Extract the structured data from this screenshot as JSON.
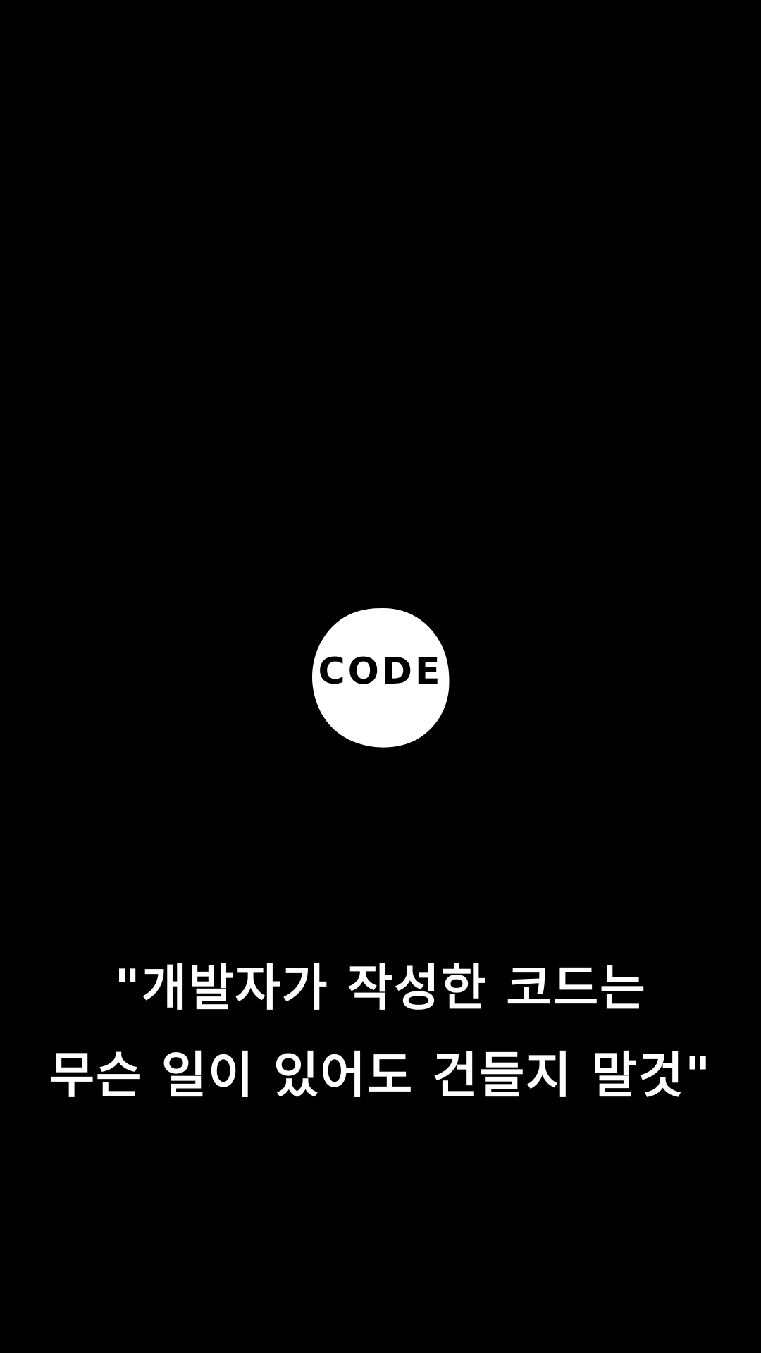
{
  "badge": {
    "label": "CODE",
    "fill_color": "#ffffff",
    "text_color": "#000000"
  },
  "caption": {
    "line1": "\"개발자가 작성한 코드는",
    "line2": "무슨 일이 있어도 건들지 말것\"",
    "color": "#ffffff"
  },
  "background_color": "#000000"
}
